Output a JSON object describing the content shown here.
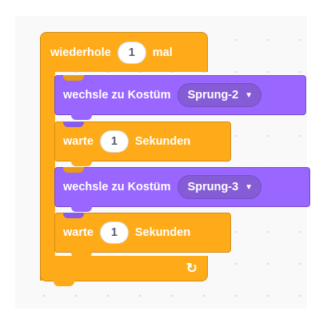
{
  "repeat": {
    "label_before": "wiederhole",
    "count": "1",
    "label_after": "mal",
    "loop_arrow": "↻"
  },
  "blocks": [
    {
      "type": "switch-costume",
      "label": "wechsle zu Kostüm",
      "costume": "Sprung-2"
    },
    {
      "type": "wait",
      "label_before": "warte",
      "seconds": "1",
      "label_after": "Sekunden"
    },
    {
      "type": "switch-costume",
      "label": "wechsle zu Kostüm",
      "costume": "Sprung-3"
    },
    {
      "type": "wait",
      "label_before": "warte",
      "seconds": "1",
      "label_after": "Sekunden"
    }
  ],
  "colors": {
    "control": "#ffab19",
    "looks": "#9966ff",
    "looks_dropdown": "#855cd6",
    "canvas": "#f9f9f9"
  },
  "icons": {
    "dropdown": "chevron-down-icon",
    "loop": "loop-arrow-icon"
  }
}
